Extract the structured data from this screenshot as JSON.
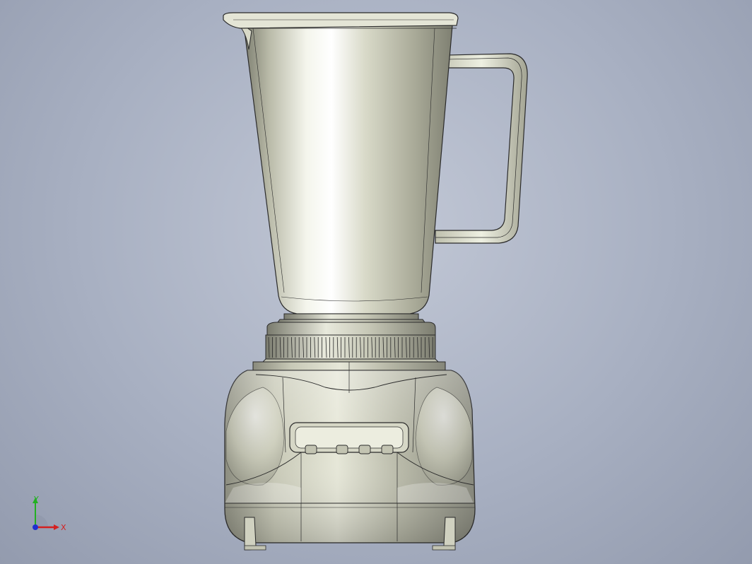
{
  "scene": {
    "background_top": "#c2c8d6",
    "background_bottom": "#939bae",
    "model_color": "#c9cab8",
    "edge_color": "#2a2a2a"
  },
  "triad": {
    "x_label": "X",
    "y_label": "Y",
    "x_color": "#d42020",
    "y_color": "#22b022",
    "z_color": "#2030d0"
  }
}
